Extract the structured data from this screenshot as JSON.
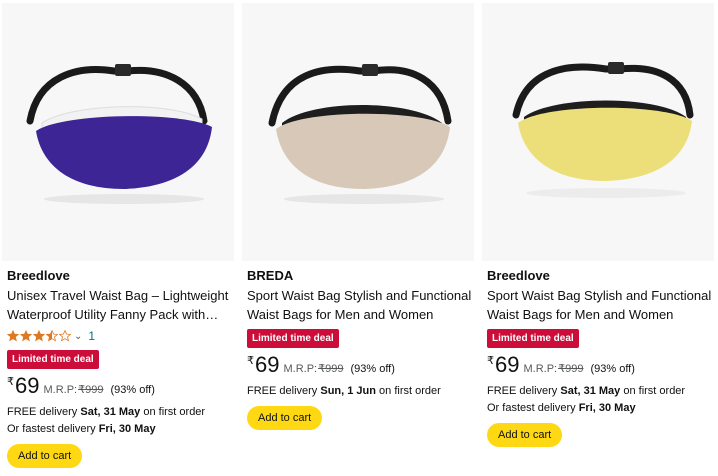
{
  "products": [
    {
      "brand": "BREDA",
      "title": "Sport Waist Bag Stylish and Functional Waist Bags for Men and Women",
      "deal_badge": "Limited time deal",
      "currency": "₹",
      "price": "69",
      "mrp_label": "M.R.P:",
      "mrp_value": "₹999",
      "discount": "(93% off)",
      "delivery_prefix": "FREE delivery",
      "delivery_date": "Sun, 1 Jun",
      "delivery_suffix": "on first order",
      "add_to_cart": "Add to cart",
      "bag_color": "#d8c8b8"
    },
    {
      "brand": "Breedlove",
      "title": "Sport Waist Bag Stylish and Functional Waist Bags for Men and Women",
      "deal_badge": "Limited time deal",
      "currency": "₹",
      "price": "69",
      "mrp_label": "M.R.P:",
      "mrp_value": "₹999",
      "discount": "(93% off)",
      "delivery_prefix": "FREE delivery",
      "delivery_date": "Sat, 31 May",
      "delivery_suffix": "on first order",
      "fastest_prefix": "Or fastest delivery",
      "fastest_date": "Fri, 30 May",
      "add_to_cart": "Add to cart",
      "bag_color": "#ecdf7a"
    },
    {
      "brand": "Breedlove",
      "title": "Unisex Travel Waist Bag – Lightweight Waterproof Utility Fanny Pack with Adjustable Strap",
      "rating_count": "1",
      "rating_stars": 3.5,
      "deal_badge": "Limited time deal",
      "currency": "₹",
      "price": "69",
      "mrp_label": "M.R.P:",
      "mrp_value": "₹999",
      "discount": "(93% off)",
      "delivery_prefix": "FREE delivery",
      "delivery_date": "Sat, 31 May",
      "delivery_suffix": "on first order",
      "fastest_prefix": "Or fastest delivery",
      "fastest_date": "Fri, 30 May",
      "add_to_cart": "Add to cart",
      "bag_color": "#3d2595"
    }
  ],
  "colors": {
    "deal_red": "#cc0c39",
    "cart_yellow": "#ffd814",
    "star_orange": "#de7921",
    "link_teal": "#007185"
  }
}
